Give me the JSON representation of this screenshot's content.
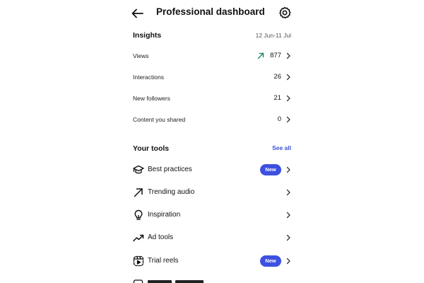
{
  "header": {
    "title": "Professional dashboard",
    "back_icon": "arrow-left-icon",
    "settings_icon": "gear-icon"
  },
  "insights": {
    "title": "Insights",
    "date_range": "12 Jun-11 Jul",
    "rows": [
      {
        "label": "Views",
        "value": "877",
        "trend": "up"
      },
      {
        "label": "Interactions",
        "value": "26"
      },
      {
        "label": "New followers",
        "value": "21"
      },
      {
        "label": "Content you shared",
        "value": "0"
      }
    ]
  },
  "tools": {
    "title": "Your tools",
    "see_all": "See all",
    "items": [
      {
        "label": "Best practices",
        "icon": "graduation-cap-icon",
        "badge": "New"
      },
      {
        "label": "Trending audio",
        "icon": "arrow-up-right-icon"
      },
      {
        "label": "Inspiration",
        "icon": "lightbulb-icon"
      },
      {
        "label": "Ad tools",
        "icon": "chart-trend-icon"
      },
      {
        "label": "Trial reels",
        "icon": "reels-icon",
        "badge": "New"
      }
    ]
  },
  "colors": {
    "accent": "#3b4fd8",
    "badge_bg": "#3d50e0",
    "trend_up": "#1a8a5a"
  }
}
